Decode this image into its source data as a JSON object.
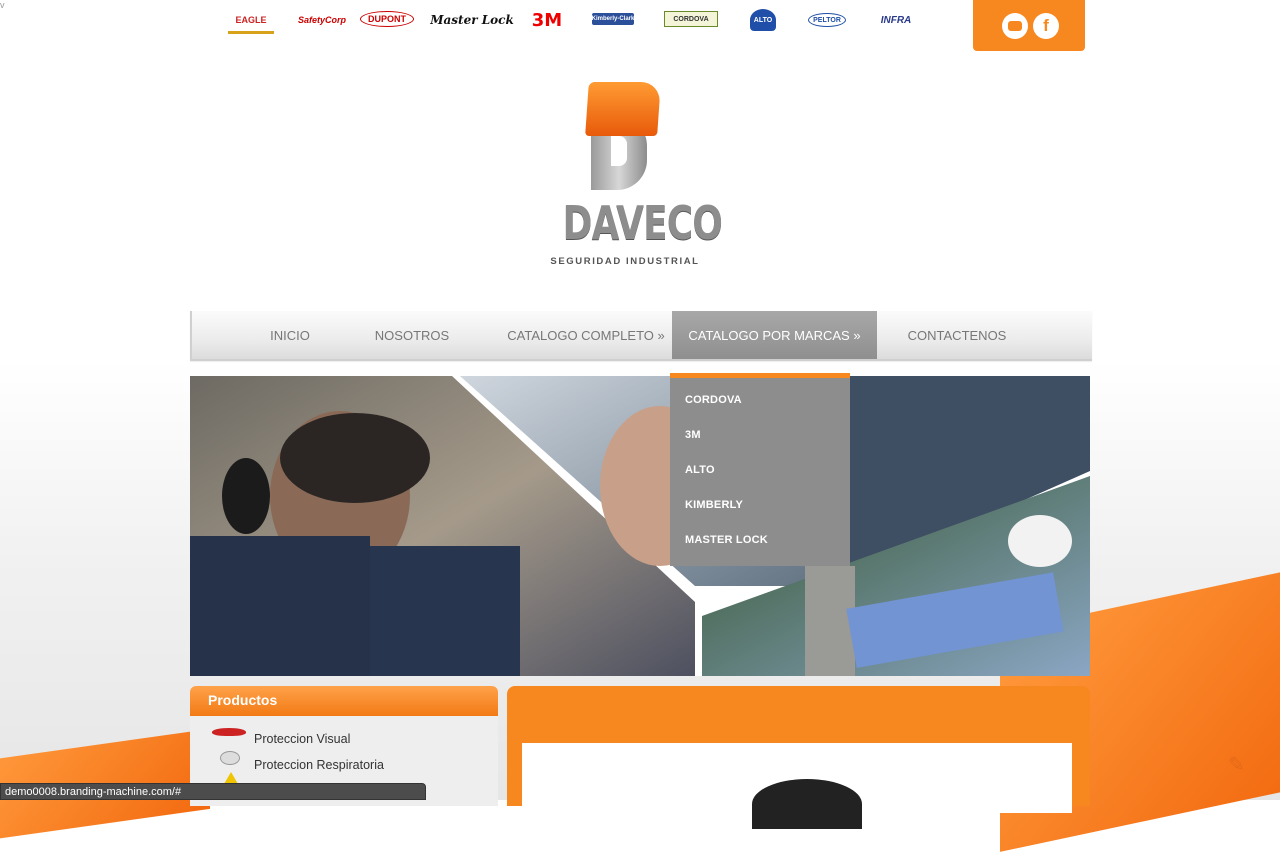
{
  "corner_mark": "v",
  "brands": [
    {
      "name": "EAGLE",
      "icon": "eagle-logo"
    },
    {
      "name": "SafetyCorp",
      "icon": "safety-corp-logo"
    },
    {
      "name": "DUPONT",
      "icon": "dupont-logo"
    },
    {
      "name": "Master Lock",
      "icon": "master-lock-logo"
    },
    {
      "name": "3M",
      "icon": "3m-logo"
    },
    {
      "name": "Kimberly-Clark",
      "icon": "kimberly-clark-logo"
    },
    {
      "name": "CORDOVA",
      "icon": "cordova-logo"
    },
    {
      "name": "ALTO",
      "icon": "alto-logo"
    },
    {
      "name": "PELTOR",
      "icon": "peltor-logo"
    },
    {
      "name": "INFRA",
      "icon": "infra-logo"
    }
  ],
  "social": {
    "chat_icon": "chat-bubble-icon",
    "facebook_icon": "facebook-icon",
    "facebook_glyph": "f"
  },
  "logo": {
    "word": "DAVECO",
    "tagline": "SEGURIDAD INDUSTRIAL"
  },
  "nav": {
    "items": [
      {
        "label": "INICIO"
      },
      {
        "label": "NOSOTROS"
      },
      {
        "label": "CATALOGO COMPLETO »"
      },
      {
        "label": "CATALOGO POR MARCAS »",
        "active": true
      },
      {
        "label": "CONTACTENOS"
      }
    ]
  },
  "dropdown": {
    "items": [
      "CORDOVA",
      "3M",
      "ALTO",
      "KIMBERLY",
      "MASTER LOCK"
    ]
  },
  "productos": {
    "title": "Productos",
    "items": [
      {
        "label": "Proteccion Visual",
        "icon": "safety-glasses-icon"
      },
      {
        "label": "Proteccion Respiratoria",
        "icon": "respirator-mask-icon"
      }
    ]
  },
  "status_bar": {
    "url": "demo0008.branding-machine.com/#"
  },
  "colors": {
    "accent": "#f7881f",
    "nav_active": "#999999",
    "dropdown_bg": "#8d8d8d"
  }
}
